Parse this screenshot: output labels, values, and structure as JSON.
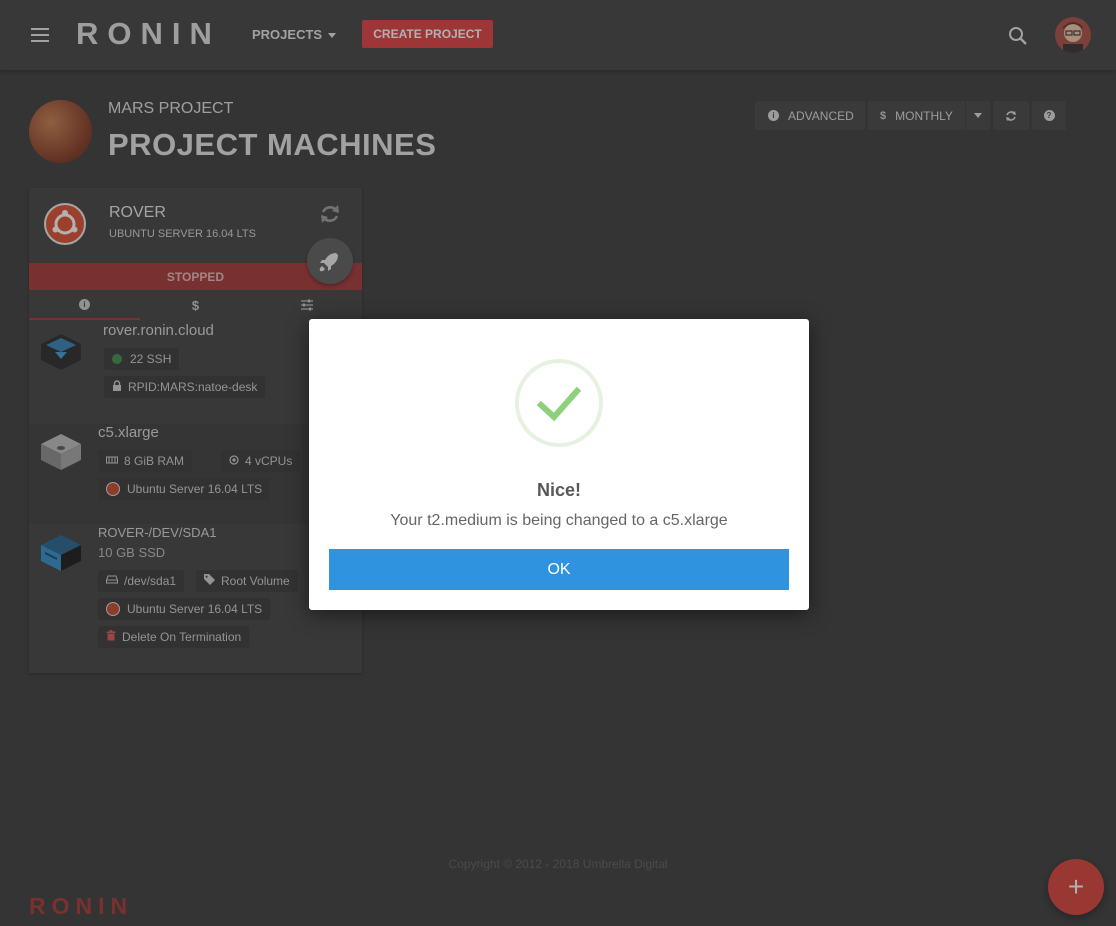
{
  "topbar": {
    "brand": "RONIN",
    "projects_label": "PROJECTS",
    "create_label": "CREATE PROJECT"
  },
  "header": {
    "project_name": "MARS PROJECT",
    "title": "PROJECT MACHINES"
  },
  "toolbar": {
    "advanced_label": "ADVANCED",
    "monthly_label": "MONTHLY"
  },
  "machine": {
    "name": "ROVER",
    "os": "UBUNTU SERVER 16.04 LTS",
    "status": "STOPPED",
    "tabs": [
      "info-icon",
      "dollar-icon",
      "sliders-icon"
    ],
    "network": {
      "host": "rover.ronin.cloud",
      "ssh": "22 SSH",
      "key": "RPID:MARS:natoe-desk"
    },
    "instance": {
      "type": "c5.xlarge",
      "ram": "8 GiB RAM",
      "cpus": "4 vCPUs",
      "os": "Ubuntu Server 16.04 LTS"
    },
    "volume": {
      "name": "ROVER-/DEV/SDA1",
      "size": "10 GB SSD",
      "device": "/dev/sda1",
      "role": "Root Volume",
      "os": "Ubuntu Server 16.04 LTS",
      "delete": "Delete On Termination"
    }
  },
  "dialog": {
    "title": "Nice!",
    "message": "Your t2.medium is being changed to a c5.xlarge",
    "ok_label": "OK"
  },
  "footer": {
    "copyright": "Copyright © 2012 - 2018 Umbrella Digital",
    "brand": "RONIN"
  },
  "colors": {
    "accent": "#e0383b",
    "status_stopped": "#a5302f",
    "ok_button": "#2f93e0",
    "success": "#8fd07a"
  }
}
